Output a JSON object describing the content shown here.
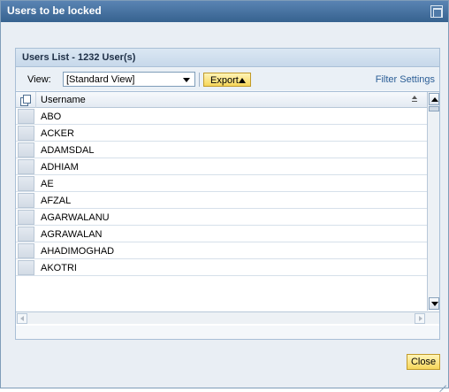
{
  "dialog": {
    "title": "Users to be locked"
  },
  "panel": {
    "title": "Users List - 1232 User(s)"
  },
  "toolbar": {
    "view_label": "View:",
    "view_value": "[Standard View]",
    "export_label": "Export",
    "filter_settings": "Filter Settings"
  },
  "table": {
    "column_header": "Username",
    "rows": [
      "ABO",
      "ACKER",
      "ADAMSDAL",
      "ADHIAM",
      "AE",
      "AFZAL",
      "AGARWALANU",
      "AGRAWALAN",
      "AHADIMOGHAD",
      "AKOTRI"
    ]
  },
  "footer": {
    "close_label": "Close"
  },
  "icons": {
    "window_button": "maximize-icon",
    "select_all": "select-all-icon",
    "sort": "sort-icon",
    "dropdown": "chevron-down-icon",
    "export": "triangle-up-icon"
  }
}
